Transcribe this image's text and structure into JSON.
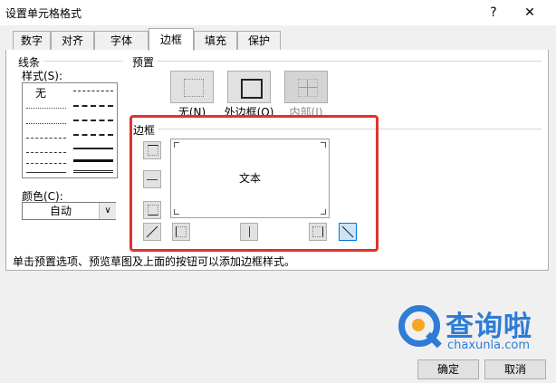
{
  "window": {
    "title": "设置单元格格式",
    "help_glyph": "?",
    "close_glyph": "✕"
  },
  "tabs": [
    {
      "label": "数字"
    },
    {
      "label": "对齐"
    },
    {
      "label": "字体"
    },
    {
      "label": "边框",
      "active": true
    },
    {
      "label": "填充"
    },
    {
      "label": "保护"
    }
  ],
  "line": {
    "group_label": "线条",
    "style_label": "样式(S):",
    "none_label": "无",
    "color_label": "颜色(C):",
    "color_value": "自动",
    "dropdown_glyph": "∨"
  },
  "presets": {
    "group_label": "预置",
    "items": [
      {
        "label": "无(N)"
      },
      {
        "label": "外边框(O)"
      },
      {
        "label": "内部(I)",
        "disabled": true
      }
    ]
  },
  "border": {
    "group_label": "边框",
    "preview_text": "文本"
  },
  "hint": "单击预置选项、预览草图及上面的按钮可以添加边框样式。",
  "footer": {
    "ok_label": "确定",
    "cancel_label": "取消"
  },
  "watermark": {
    "title": "查询啦",
    "url": "chaxunla.com"
  },
  "colors": {
    "highlight": "#e0322b",
    "watermark_blue": "#2e7cd6",
    "watermark_orange": "#f5a623"
  }
}
